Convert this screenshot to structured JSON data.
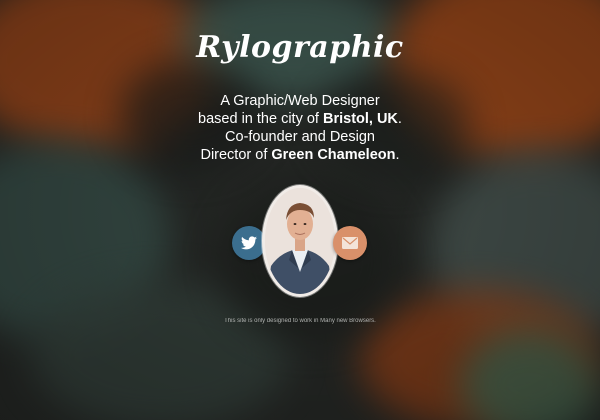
{
  "brand": {
    "logo_text": "Rylographic"
  },
  "bio": {
    "line1": "A Graphic/Web Designer",
    "line2_pre": "based in the city of ",
    "line2_bold": "Bristol, UK",
    "line2_post": ".",
    "line3": "Co-founder and Design",
    "line4_pre": "Director of ",
    "line4_bold": "Green Chameleon",
    "line4_post": "."
  },
  "social": {
    "twitter_icon": "twitter-bird-icon",
    "mail_icon": "envelope-icon",
    "twitter_color": "#3b6e8e",
    "mail_color": "#d9906a"
  },
  "avatar": {
    "icon": "profile-photo"
  },
  "footer": {
    "note": "This site is only designed to work in Many new Browsers."
  }
}
